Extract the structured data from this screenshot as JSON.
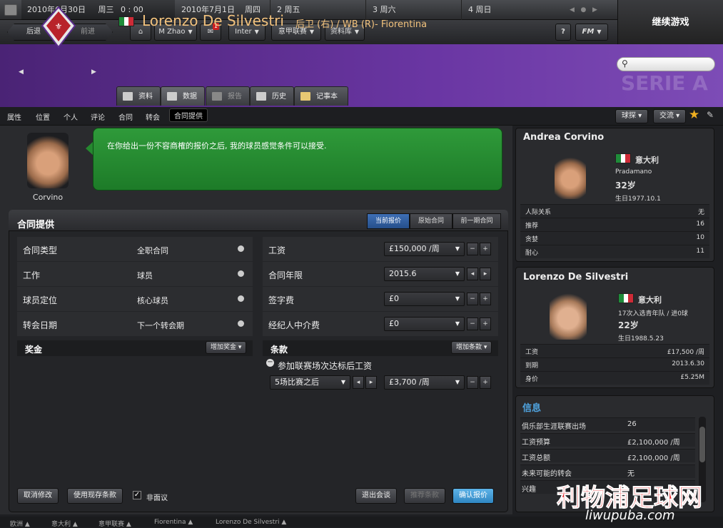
{
  "datebar": {
    "current": "2010年6月30日",
    "current_day": "周三",
    "current_time": "0 : 00",
    "days": [
      {
        "date": "2010年7月1日",
        "weekday": "周四"
      },
      {
        "date": "2",
        "weekday": "周五"
      },
      {
        "date": "3",
        "weekday": "周六"
      },
      {
        "date": "4",
        "weekday": "周日"
      }
    ]
  },
  "continue_label": "继续游戏",
  "toolbar": {
    "back": "后退",
    "forward": "前进",
    "manager": "M Zhao",
    "inbox_count": "1",
    "club": "Inter",
    "league": "意甲联赛",
    "database": "资料库",
    "help": "?",
    "fm": "FM"
  },
  "player": {
    "name": "Lorenzo De Silvestri",
    "info": "后卫 (右) / WB (R)- Fiorentina",
    "watermark": "SERIE A"
  },
  "player_tabs": [
    "资料",
    "数据",
    "报告",
    "历史",
    "记事本"
  ],
  "subnav": [
    "属性",
    "位置",
    "个人",
    "评论",
    "合同",
    "转会",
    "合同提供"
  ],
  "subnav_right": {
    "scout": "球探",
    "interact": "交流"
  },
  "agent": {
    "name": "Corvino",
    "message": "在你给出一份不容商榷的报价之后, 我的球员感觉条件可以接受."
  },
  "offer": {
    "title": "合同提供",
    "segments": [
      "当前报价",
      "原始合同",
      "前一期合同"
    ],
    "left_rows": [
      {
        "label": "合同类型",
        "value": "全职合同"
      },
      {
        "label": "工作",
        "value": "球员"
      },
      {
        "label": "球员定位",
        "value": "核心球员"
      },
      {
        "label": "转会日期",
        "value": "下一个转会期"
      }
    ],
    "right_rows": [
      {
        "label": "工资",
        "value": "£150,000 /周"
      },
      {
        "label": "合同年限",
        "value": "2015.6"
      },
      {
        "label": "签字费",
        "value": "£0"
      },
      {
        "label": "经纪人中介费",
        "value": "£0"
      }
    ],
    "bonus_title": "奖金",
    "bonus_add": "增加奖金",
    "clauses_title": "条款",
    "clauses_add": "增加条款",
    "clause_name": "参加联赛场次达标后工资",
    "clause_condition": "5场比赛之后",
    "clause_value": "£3,700 /周",
    "buttons": {
      "cancel": "取消修改",
      "use_existing": "使用现存条款",
      "non_contract": "非面议",
      "leave": "退出会谈",
      "suggest": "推荐条款",
      "confirm": "确认报价"
    }
  },
  "card1": {
    "name": "Andrea Corvino",
    "nation": "意大利",
    "club": "Pradamano",
    "age": "32岁",
    "dob": "生日1977.10.1",
    "rows": [
      {
        "label": "人际关系",
        "value": "无"
      },
      {
        "label": "推荐",
        "value": "16"
      },
      {
        "label": "贪婪",
        "value": "10"
      },
      {
        "label": "耐心",
        "value": "11"
      }
    ]
  },
  "card2": {
    "name": "Lorenzo De Silvestri",
    "nation": "意大利",
    "caps": "17次入选青年队 / 进0球",
    "age": "22岁",
    "dob": "生日1988.5.23",
    "rows": [
      {
        "label": "工资",
        "value": "£17,500 /周"
      },
      {
        "label": "到期",
        "value": "2013.6.30"
      },
      {
        "label": "身价",
        "value": "£5.25M"
      }
    ]
  },
  "card3": {
    "title": "信息",
    "rows": [
      {
        "label": "俱乐部生涯联赛出场",
        "value": "26"
      },
      {
        "label": "工资预算",
        "value": "£2,100,000 /周"
      },
      {
        "label": "工资总额",
        "value": "£2,100,000 /周"
      },
      {
        "label": "未来可能的转会",
        "value": "无"
      },
      {
        "label": "兴趣",
        "value": ""
      }
    ]
  },
  "crumbs": [
    "欧洲",
    "意大利",
    "意甲联赛",
    "Fiorentina",
    "Lorenzo De Silvestri"
  ],
  "watermark": {
    "cn": "利物浦足球网",
    "url": "liwupuba.com"
  },
  "colors": {
    "header_purple": "#5a2c8c",
    "bubble_green": "#2a8f34",
    "accent_blue": "#3e6fb5",
    "name_gold": "#f2c27d"
  }
}
